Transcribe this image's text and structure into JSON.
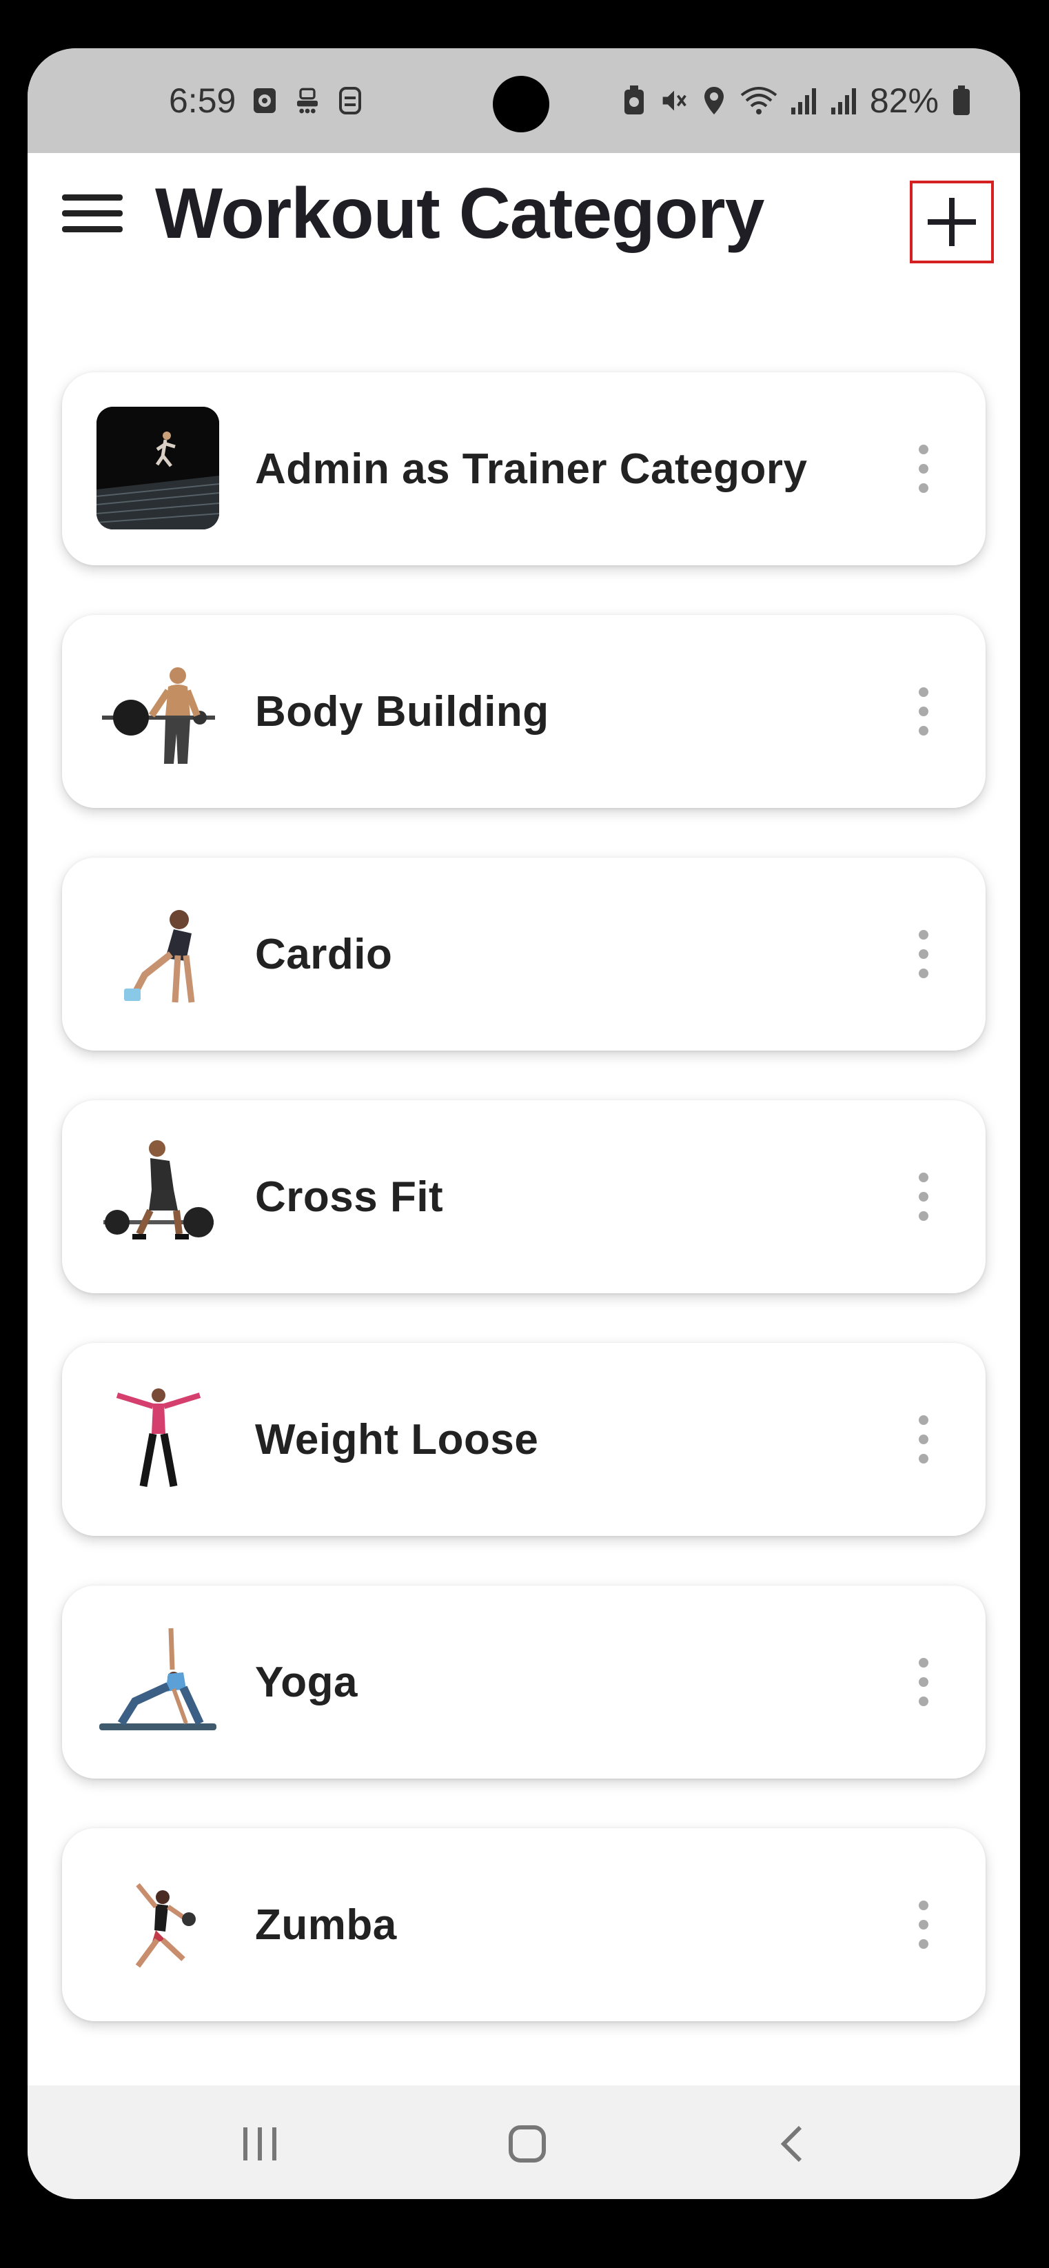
{
  "status_bar": {
    "time": "6:59",
    "battery": "82%"
  },
  "header": {
    "title": "Workout Category",
    "menu_icon": "hamburger-menu-icon",
    "add_icon": "plus-icon"
  },
  "categories": [
    {
      "label": "Admin as Trainer Category",
      "thumb": "runner-dark-photo"
    },
    {
      "label": "Body Building",
      "thumb": "bodybuilder-barbell-photo"
    },
    {
      "label": "Cardio",
      "thumb": "plank-woman-photo"
    },
    {
      "label": "Cross Fit",
      "thumb": "deadlift-man-photo"
    },
    {
      "label": "Weight Loose",
      "thumb": "jumping-jack-woman-photo"
    },
    {
      "label": "Yoga",
      "thumb": "yoga-triangle-photo"
    },
    {
      "label": "Zumba",
      "thumb": "dance-woman-photo"
    }
  ],
  "nav_bar": {
    "recents_icon": "recents-icon",
    "home_icon": "home-icon",
    "back_icon": "back-icon"
  },
  "colors": {
    "status_bar_bg": "#c8c8c8",
    "highlight_border": "#d42020",
    "title_text": "#1e1e24"
  }
}
